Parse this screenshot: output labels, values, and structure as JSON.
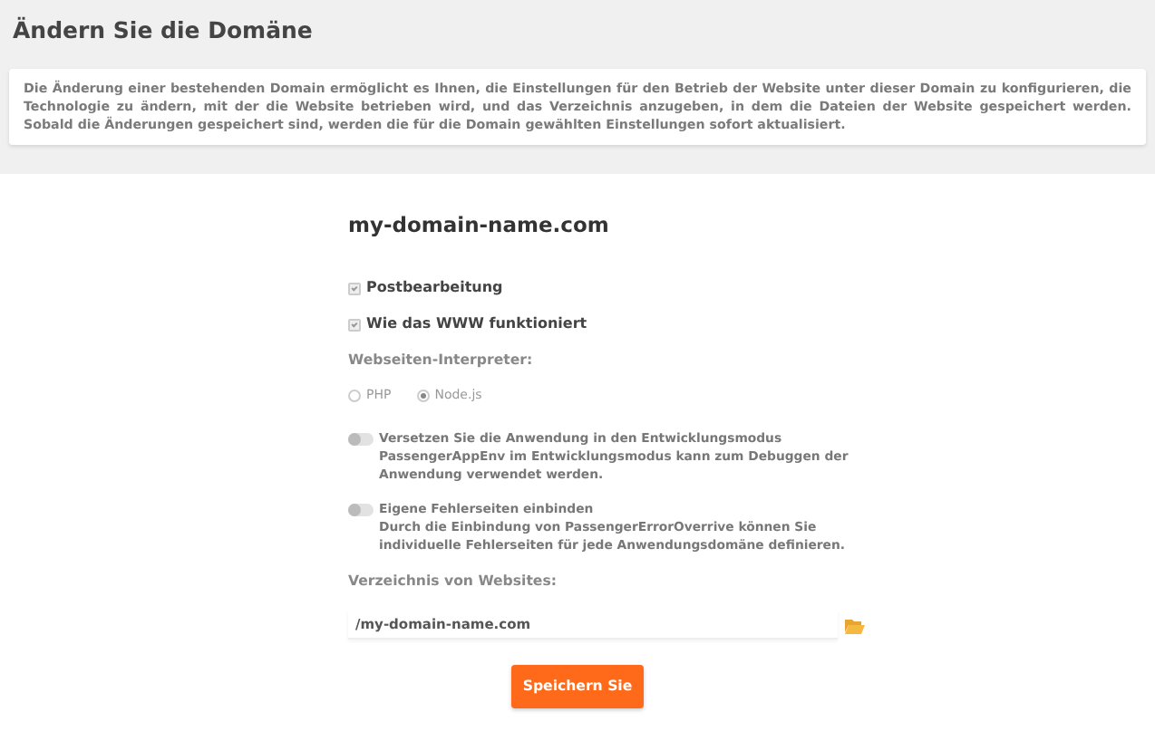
{
  "page_title": "Ändern Sie die Domäne",
  "info": "Die Änderung einer bestehenden Domain ermöglicht es Ihnen, die Einstellungen für den Betrieb der Website unter dieser Domain zu konfigurieren, die Technologie zu ändern, mit der die Website betrieben wird, und das Verzeichnis anzugeben, in dem die Dateien der Website gespeichert werden. Sobald die Änderungen gespeichert sind, werden die für die Domain gewählten Einstellungen sofort aktualisiert.",
  "domain": "my-domain-name.com",
  "checkboxes": [
    {
      "label": "Postbearbeitung",
      "checked": true
    },
    {
      "label": "Wie das WWW funktioniert",
      "checked": true
    }
  ],
  "interpreter": {
    "label": "Webseiten-Interpreter:",
    "options": [
      {
        "label": "PHP",
        "selected": false
      },
      {
        "label": "Node.js",
        "selected": true
      }
    ]
  },
  "toggles": [
    {
      "label": "Versetzen Sie die Anwendung in den Entwicklungsmodus",
      "description": "PassengerAppEnv im Entwicklungsmodus kann zum Debuggen der Anwendung verwendet werden.",
      "on": false
    },
    {
      "label": "Eigene Fehlerseiten einbinden",
      "description": "Durch die Einbindung von PassengerErrorOverrive können Sie individuelle Fehlerseiten für jede Anwendungsdomäne definieren.",
      "on": false
    }
  ],
  "directory": {
    "label": "Verzeichnis von Websites:",
    "value": "/my-domain-name.com"
  },
  "save_button": "Speichern Sie"
}
